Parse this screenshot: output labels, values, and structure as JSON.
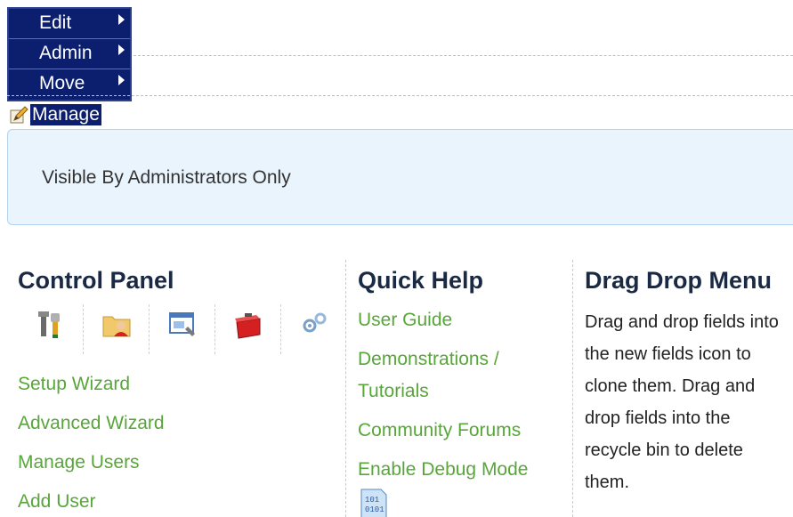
{
  "manage_menu": {
    "items": [
      {
        "label": "Edit"
      },
      {
        "label": "Admin"
      },
      {
        "label": "Move"
      }
    ],
    "manage_label": "Manage",
    "manage_icon": "pencil-edit-icon"
  },
  "notice": {
    "text": "Visible By Administrators Only",
    "background": "#eaf4fd"
  },
  "control_panel": {
    "title": "Control Panel",
    "icons": [
      "tools-icon",
      "user-folder-icon",
      "window-settings-icon",
      "toolbox-icon",
      "gears-icon"
    ],
    "links": [
      "Setup Wizard",
      "Advanced Wizard",
      "Manage Users",
      "Add User"
    ]
  },
  "quick_help": {
    "title": "Quick Help",
    "links": [
      "User Guide",
      "Demonstrations / Tutorials",
      "Community Forums",
      "Enable Debug Mode"
    ],
    "debug_icon": "binary-file-icon"
  },
  "drag_drop_menu": {
    "title": "Drag Drop Menu",
    "description": "Drag and drop fields into the new fields icon to clone them. Drag and drop fields into the recycle bin to delete them."
  },
  "colors": {
    "menu_bg": "#0b1f6e",
    "link": "#58a63a",
    "heading": "#1a2a44"
  }
}
